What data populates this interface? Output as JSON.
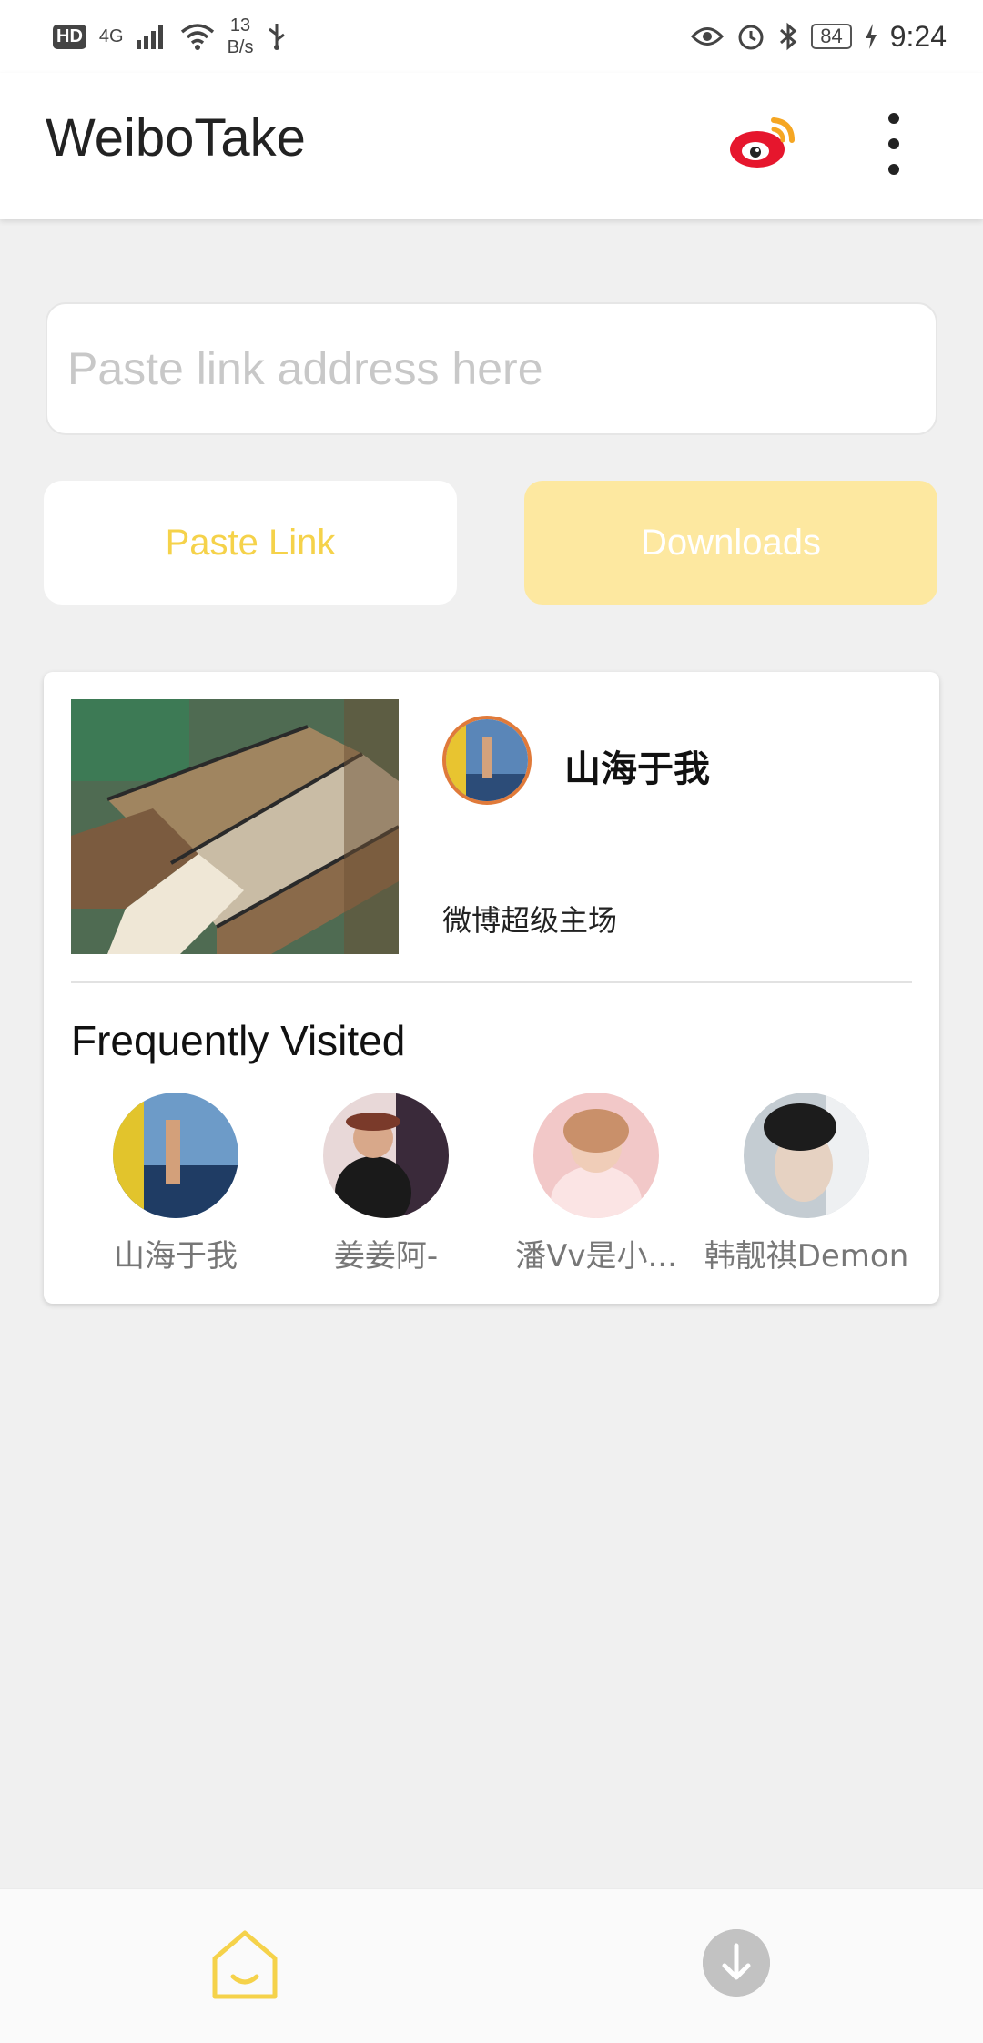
{
  "status_bar": {
    "hd": "HD",
    "network": "4G",
    "speed_value": "13",
    "speed_unit": "B/s",
    "battery": "84",
    "time": "9:24"
  },
  "app_bar": {
    "title": "WeiboTake",
    "logo_icon": "weibo-logo-icon",
    "menu_icon": "more-vertical-icon"
  },
  "link_input": {
    "placeholder": "Paste link address here",
    "value": ""
  },
  "buttons": {
    "paste": "Paste Link",
    "downloads": "Downloads"
  },
  "post": {
    "author": "山海于我",
    "source": "微博超级主场"
  },
  "frequently_visited": {
    "title": "Frequently Visited",
    "items": [
      {
        "name": "山海于我"
      },
      {
        "name": "姜姜阿-"
      },
      {
        "name": "潘Vv是小..."
      },
      {
        "name": "韩靓祺Demon"
      }
    ]
  },
  "bottom_nav": {
    "home_icon": "home-icon",
    "downloads_icon": "download-icon"
  },
  "colors": {
    "accent": "#f5d24a",
    "accent_light": "#fde8a0",
    "background": "#f0f0f0",
    "weibo_red": "#e6162d"
  }
}
